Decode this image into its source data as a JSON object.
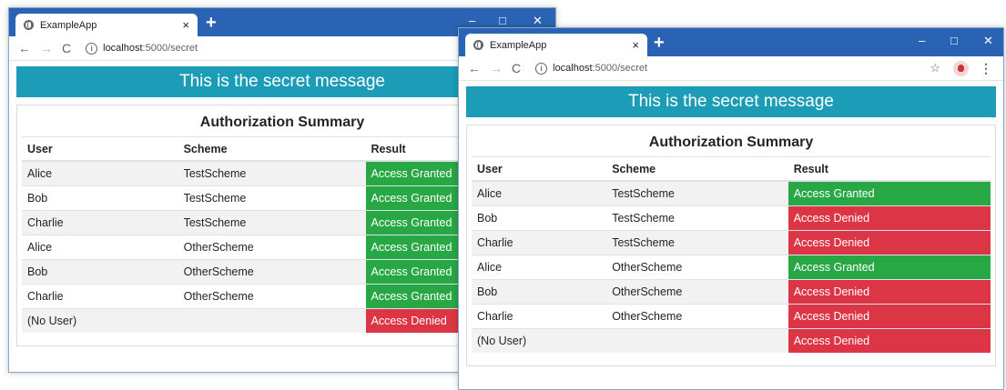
{
  "colors": {
    "titlebar": "#2b63b4",
    "banner": "#1c9cb6",
    "granted": "#28a745",
    "denied": "#dc3545"
  },
  "icons": {
    "favicon": "globe-icon",
    "back": "arrow-left-icon",
    "forward": "arrow-right-icon",
    "reload": "reload-icon",
    "info": "info-icon",
    "bookmark": "star-icon",
    "menu": "more-vert-icon"
  },
  "window_back": {
    "tab_title": "ExampleApp",
    "tab_close": "×",
    "new_tab": "+",
    "minimize": "–",
    "maximize": "□",
    "close": "✕",
    "url_host": "localhost",
    "url_path": ":5000/secret",
    "banner": "This is the secret message",
    "summary_title": "Authorization Summary",
    "headers": [
      "User",
      "Scheme",
      "Result"
    ],
    "rows": [
      {
        "user": "Alice",
        "scheme": "TestScheme",
        "result": "Access Granted"
      },
      {
        "user": "Bob",
        "scheme": "TestScheme",
        "result": "Access Granted"
      },
      {
        "user": "Charlie",
        "scheme": "TestScheme",
        "result": "Access Granted"
      },
      {
        "user": "Alice",
        "scheme": "OtherScheme",
        "result": "Access Granted"
      },
      {
        "user": "Bob",
        "scheme": "OtherScheme",
        "result": "Access Granted"
      },
      {
        "user": "Charlie",
        "scheme": "OtherScheme",
        "result": "Access Granted"
      },
      {
        "user": "(No User)",
        "scheme": "",
        "result": "Access Denied"
      }
    ]
  },
  "window_front": {
    "tab_title": "ExampleApp",
    "tab_close": "×",
    "new_tab": "+",
    "minimize": "–",
    "maximize": "□",
    "close": "✕",
    "url_host": "localhost",
    "url_path": ":5000/secret",
    "banner": "This is the secret message",
    "summary_title": "Authorization Summary",
    "headers": [
      "User",
      "Scheme",
      "Result"
    ],
    "rows": [
      {
        "user": "Alice",
        "scheme": "TestScheme",
        "result": "Access Granted"
      },
      {
        "user": "Bob",
        "scheme": "TestScheme",
        "result": "Access Denied"
      },
      {
        "user": "Charlie",
        "scheme": "TestScheme",
        "result": "Access Denied"
      },
      {
        "user": "Alice",
        "scheme": "OtherScheme",
        "result": "Access Granted"
      },
      {
        "user": "Bob",
        "scheme": "OtherScheme",
        "result": "Access Denied"
      },
      {
        "user": "Charlie",
        "scheme": "OtherScheme",
        "result": "Access Denied"
      },
      {
        "user": "(No User)",
        "scheme": "",
        "result": "Access Denied"
      }
    ]
  }
}
